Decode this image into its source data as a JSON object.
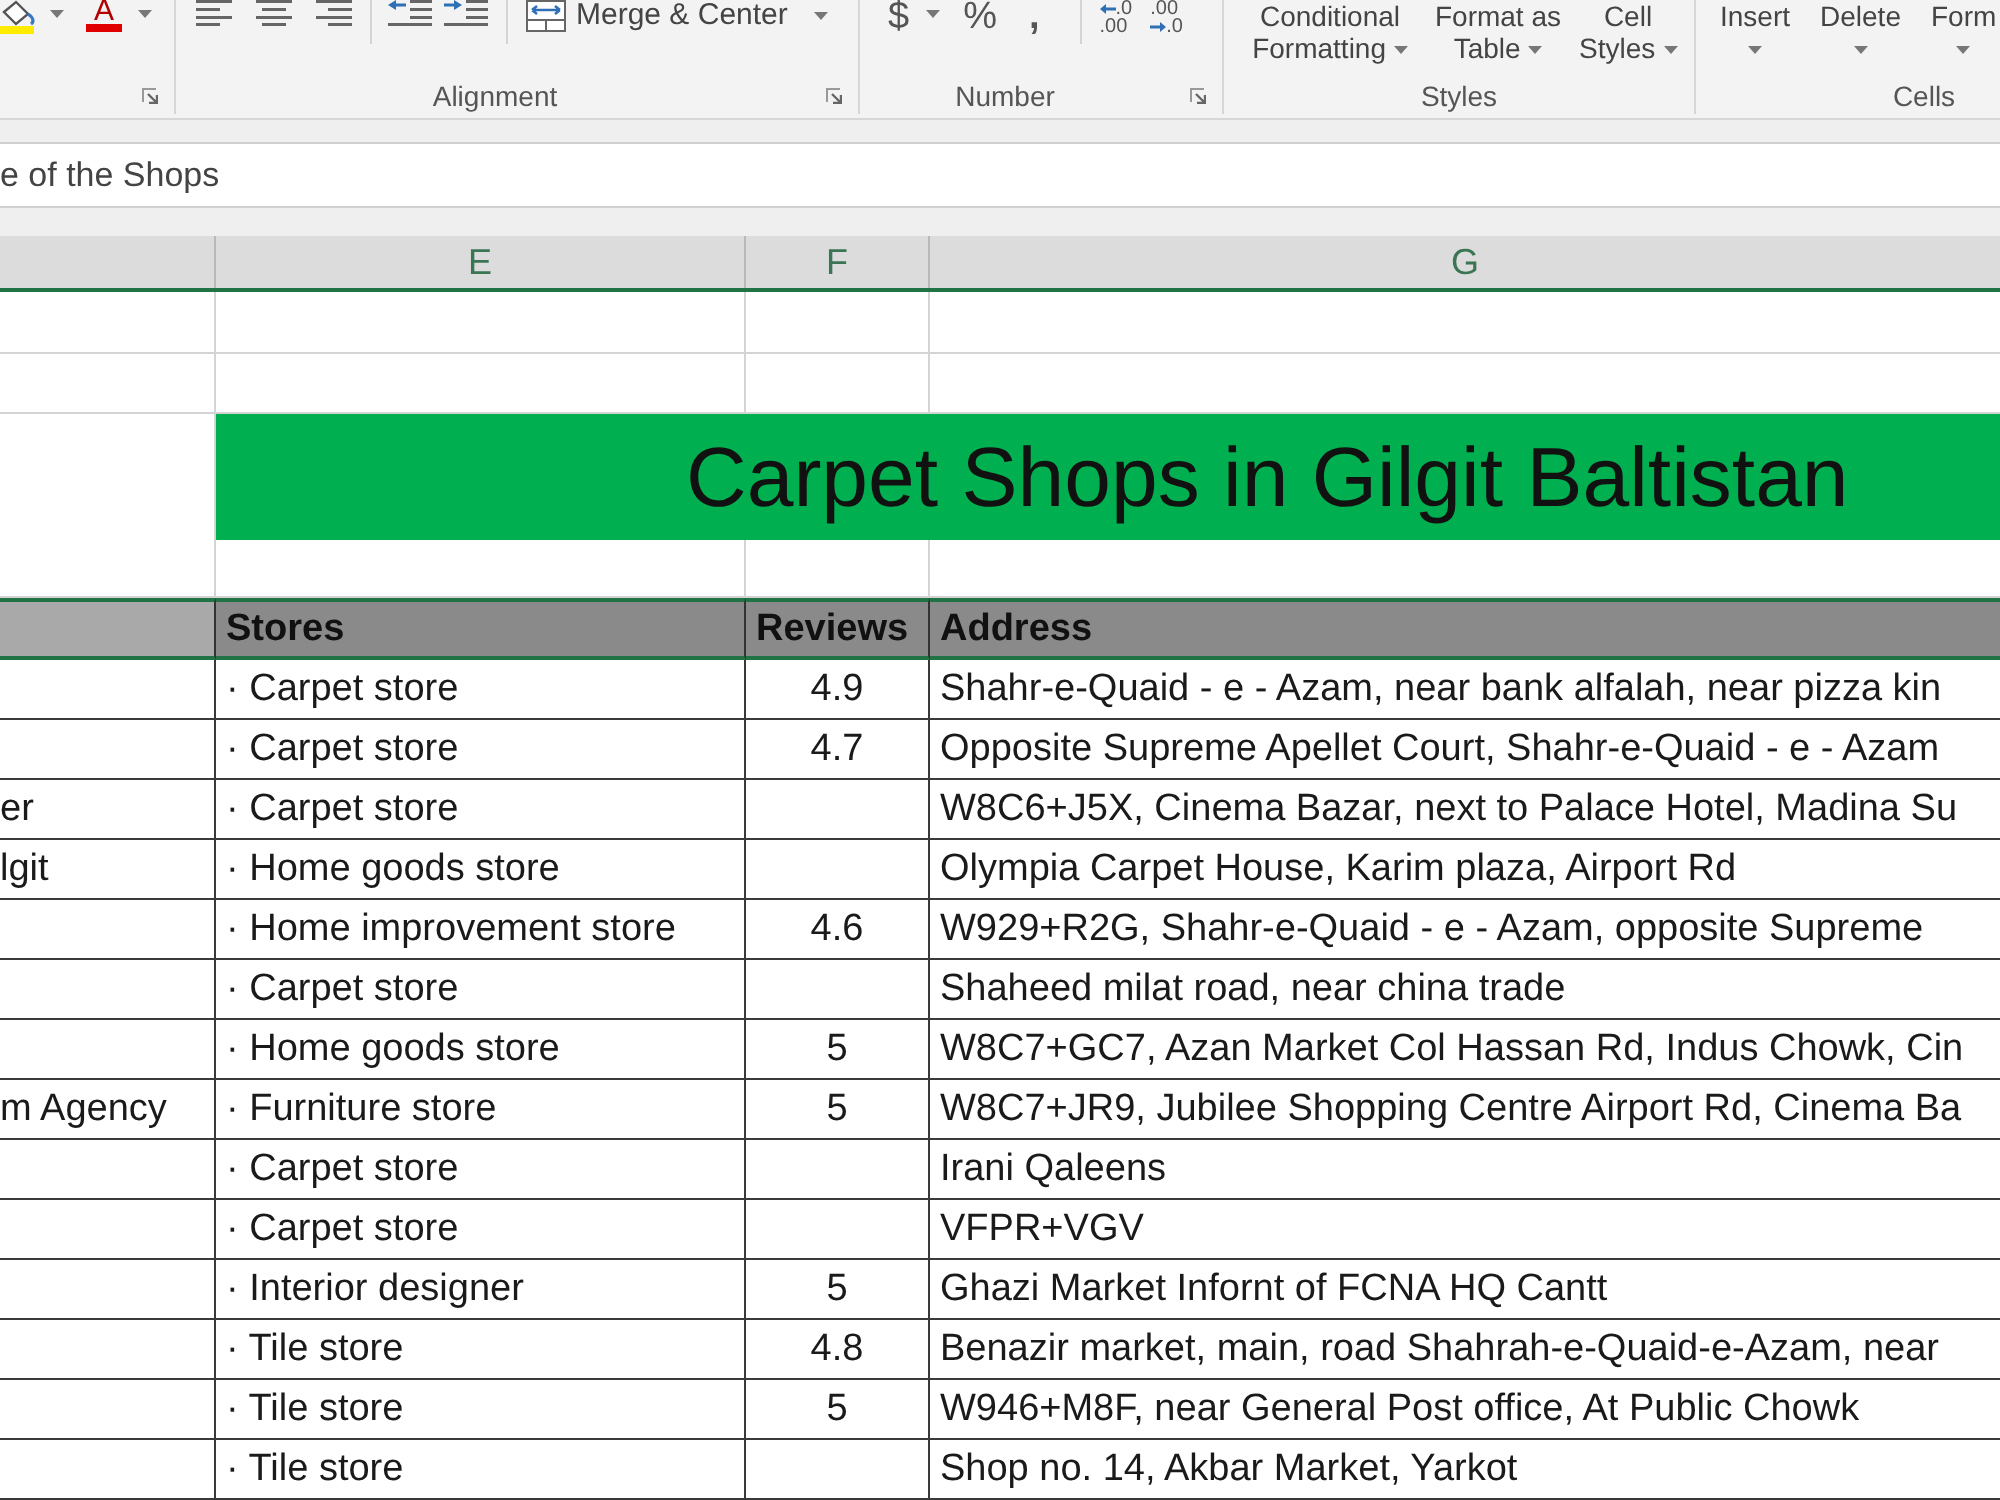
{
  "ribbon": {
    "font": {
      "font_color_button": "A"
    },
    "alignment": {
      "merge_button": "Merge & Center",
      "label": "Alignment"
    },
    "number": {
      "currency": "$",
      "percent": "%",
      "comma": ",",
      "decimal_buttons": [
        {
          "kind": "increase",
          "upper": ".0",
          "lower": ".00"
        },
        {
          "kind": "decrease",
          "upper": ".00",
          "lower": ".0"
        }
      ],
      "label": "Number"
    },
    "styles": {
      "buttons": [
        "Conditional Formatting",
        "Format as Table",
        "Cell Styles"
      ],
      "label": "Styles"
    },
    "cells": {
      "buttons": [
        "Insert",
        "Delete",
        "Form"
      ],
      "label": "Cells"
    }
  },
  "formula_bar": {
    "value": "e of the Shops"
  },
  "column_headers": [
    "E",
    "F",
    "G"
  ],
  "title": "Carpet Shops in Gilgit Baltistan",
  "table": {
    "columns": [
      "Stores",
      "Reviews",
      "Address"
    ],
    "rows": [
      {
        "stores": "· Carpet store",
        "reviews": "4.9",
        "address": "Shahr-e-Quaid - e - Azam, near bank alfalah, near pizza kin"
      },
      {
        "stores": "· Carpet store",
        "reviews": "4.7",
        "address": "Opposite Supreme Apellet Court, Shahr-e-Quaid - e - Azam"
      },
      {
        "column_1": "er",
        "stores": "· Carpet store",
        "address": "W8C6+J5X, Cinema Bazar, next to Palace Hotel, Madina Su"
      },
      {
        "column_1": "lgit",
        "stores": "· Home goods store",
        "address": "Olympia Carpet House, Karim plaza, Airport Rd"
      },
      {
        "stores": "· Home improvement store",
        "reviews": "4.6",
        "address": "W929+R2G, Shahr-e-Quaid - e - Azam, opposite Supreme"
      },
      {
        "stores": "· Carpet store",
        "address": "Shaheed milat road, near china trade"
      },
      {
        "stores": "· Home goods store",
        "reviews": "5",
        "address": "W8C7+GC7, Azan Market Col Hassan Rd, Indus Chowk, Cin"
      },
      {
        "column_1": "m Agency",
        "stores": "· Furniture store",
        "reviews": "5",
        "address": "W8C7+JR9, Jubilee Shopping Centre Airport Rd, Cinema Ba"
      },
      {
        "stores": "· Carpet store",
        "address": "Irani Qaleens"
      },
      {
        "stores": "· Carpet store",
        "address": "VFPR+VGV"
      },
      {
        "stores": "· Interior designer",
        "reviews": "5",
        "address": "Ghazi Market Infornt of FCNA HQ Cantt"
      },
      {
        "stores": "· Tile store",
        "reviews": "4.8",
        "address": "Benazir market, main, road Shahrah-e-Quaid-e-Azam, near"
      },
      {
        "stores": "· Tile store",
        "reviews": "5",
        "address": "W946+M8F, near General Post office, At Public Chowk"
      },
      {
        "stores": "· Tile store",
        "address": "Shop no. 14, Akbar Market, Yarkot"
      }
    ]
  }
}
